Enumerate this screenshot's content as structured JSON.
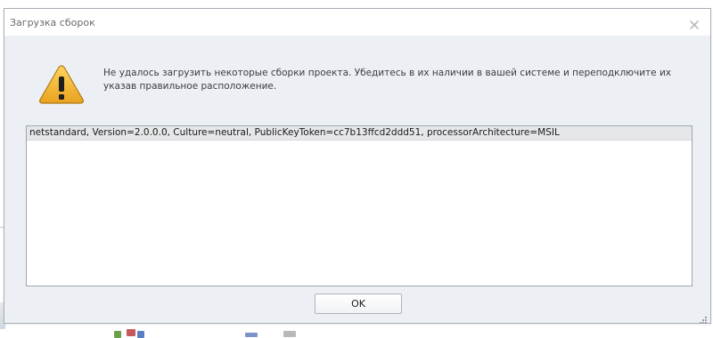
{
  "dialog": {
    "title": "Загрузка сборок",
    "message": "Не удалось загрузить некоторые сборки проекта. Убедитесь в их наличии в вашей системе и переподключите их указав правильное расположение.",
    "assemblies": [
      "netstandard, Version=2.0.0.0, Culture=neutral, PublicKeyToken=cc7b13ffcd2ddd51, processorArchitecture=MSIL"
    ],
    "ok_label": "OK"
  },
  "icons": {
    "warning": "warning-triangle-icon",
    "close": "close-icon",
    "resize": "resize-grip-icon"
  },
  "colors": {
    "dialog_bg": "#ecf0f5",
    "warning_fill": "#f2b83a",
    "warning_border": "#b07a16",
    "selected_row": "#e6e7e9"
  }
}
